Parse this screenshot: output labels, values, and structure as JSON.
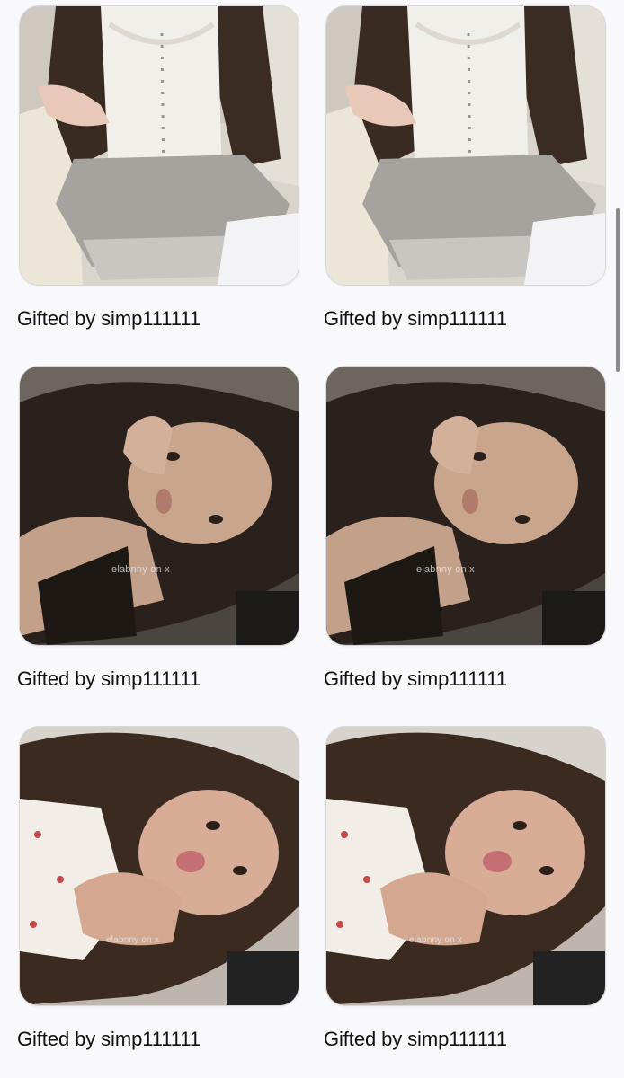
{
  "gallery": {
    "items": [
      {
        "caption": "Gifted by simp111111",
        "watermark": "",
        "scene": "white-corset-photo"
      },
      {
        "caption": "Gifted by simp111111",
        "watermark": "",
        "scene": "white-corset-photo"
      },
      {
        "caption": "Gifted by simp111111",
        "watermark": "elabnny on x",
        "scene": "dark-portrait-photo"
      },
      {
        "caption": "Gifted by simp111111",
        "watermark": "elabnny on x",
        "scene": "dark-portrait-photo"
      },
      {
        "caption": "Gifted by simp111111",
        "watermark": "elabnny on x",
        "scene": "light-portrait-photo"
      },
      {
        "caption": "Gifted by simp111111",
        "watermark": "elabnny on x",
        "scene": "light-portrait-photo"
      }
    ]
  },
  "colors": {
    "background": "#f9f9fb",
    "caption_text": "#111111",
    "scrollbar": "#8a8a8e"
  }
}
